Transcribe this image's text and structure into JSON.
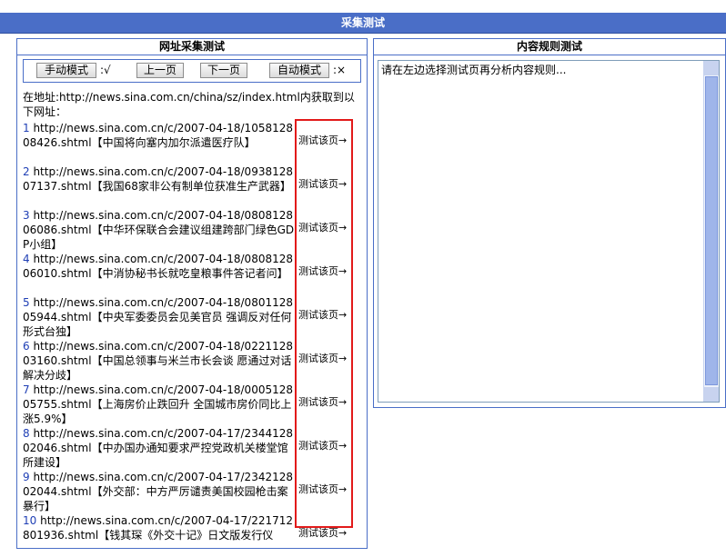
{
  "window": {
    "title": "采集测试"
  },
  "left_panel": {
    "title": "网址采集测试",
    "toolbar": {
      "manual_label": "手动模式",
      "manual_mark": ":√",
      "prev_label": "上一页",
      "next_label": "下一页",
      "auto_label": "自动模式",
      "auto_mark": ":×"
    },
    "address_line": "在地址:http://news.sina.com.cn/china/sz/index.html内获取到以下网址：",
    "items": [
      {
        "num": "1",
        "text": " http://news.sina.com.cn/c/2007-04-18/105812808426.shtml【中国将向塞内加尔派遣医疗队】",
        "link": "测试该页→"
      },
      {
        "num": "2",
        "text": " http://news.sina.com.cn/c/2007-04-18/093812807137.shtml【我国68家非公有制单位获准生产武器】",
        "link": "测试该页→"
      },
      {
        "num": "3",
        "text": " http://news.sina.com.cn/c/2007-04-18/080812806086.shtml【中华环保联合会建议组建跨部门绿色GDP小组】",
        "link": "测试该页→"
      },
      {
        "num": "4",
        "text": " http://news.sina.com.cn/c/2007-04-18/080812806010.shtml【中消协秘书长就吃皇粮事件答记者问】",
        "link": "测试该页→"
      },
      {
        "num": "5",
        "text": " http://news.sina.com.cn/c/2007-04-18/080112805944.shtml【中央军委委员会见美官员 强调反对任何形式台独】",
        "link": "测试该页→"
      },
      {
        "num": "6",
        "text": " http://news.sina.com.cn/c/2007-04-18/022112803160.shtml【中国总领事与米兰市长会谈 愿通过对话解决分歧】",
        "link": "测试该页→"
      },
      {
        "num": "7",
        "text": " http://news.sina.com.cn/c/2007-04-18/000512805755.shtml【上海房价止跌回升 全国城市房价同比上涨5.9%】",
        "link": "测试该页→"
      },
      {
        "num": "8",
        "text": " http://news.sina.com.cn/c/2007-04-17/234412802046.shtml【中办国办通知要求严控党政机关楼堂馆所建设】",
        "link": "测试该页→"
      },
      {
        "num": "9",
        "text": " http://news.sina.com.cn/c/2007-04-17/234212802044.shtml【外交部：中方严厉谴责美国校园枪击案暴行】",
        "link": "测试该页→"
      },
      {
        "num": "10",
        "text": " http://news.sina.com.cn/c/2007-04-17/221712801936.shtml【钱其琛《外交十记》日文版发行仪",
        "link": "测试该页→"
      }
    ]
  },
  "right_panel": {
    "title": "内容规则测试",
    "placeholder_text": "请在左边选择测试页再分析内容规则..."
  }
}
